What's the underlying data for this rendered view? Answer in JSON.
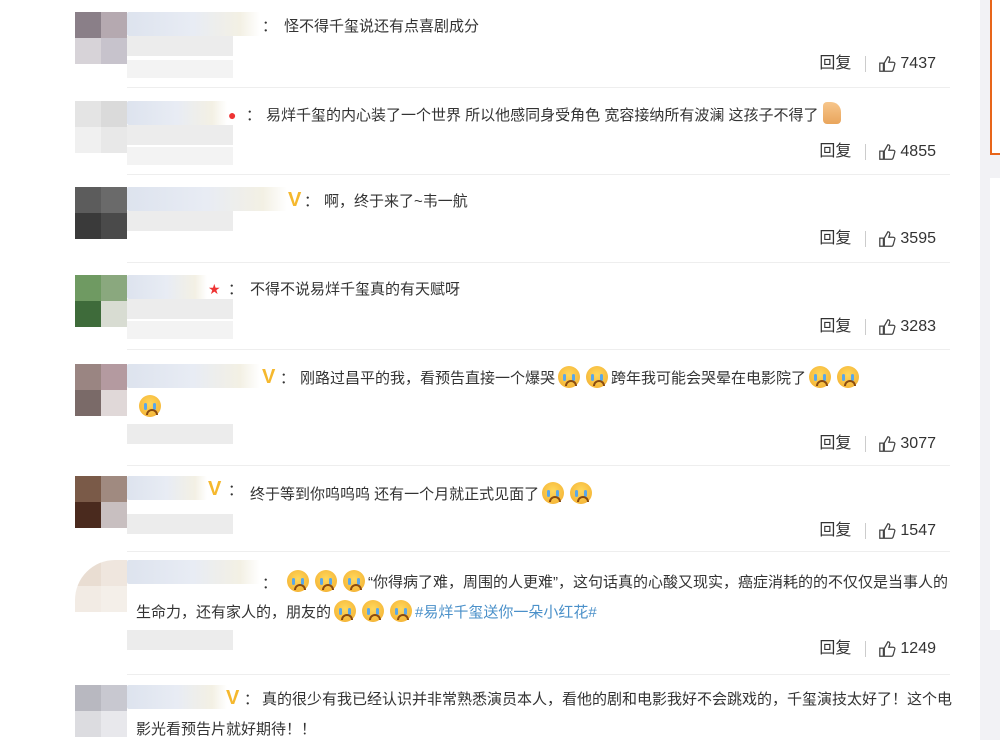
{
  "comments": [
    {
      "sep": "：",
      "text": "怪不得千玺说还有点喜剧成分",
      "reply": "回复",
      "likes": "7437"
    },
    {
      "sep": "：",
      "text": "易烊千玺的内心装了一个世界 所以他感同身受角色 宽容接纳所有波澜 这孩子不得了",
      "reply": "回复",
      "likes": "4855"
    },
    {
      "sep": "：",
      "text": "啊，终于来了~韦一航",
      "reply": "回复",
      "likes": "3595"
    },
    {
      "sep": "：",
      "text": "不得不说易烊千玺真的有天赋呀",
      "reply": "回复",
      "likes": "3283"
    },
    {
      "sep": "：",
      "text_a": "刚路过昌平的我，看预告直接一个爆哭",
      "text_b": "跨年我可能会哭晕在电影院了",
      "reply": "回复",
      "likes": "3077"
    },
    {
      "sep": "：",
      "text": "终于等到你呜呜呜 还有一个月就正式见面了",
      "reply": "回复",
      "likes": "1547"
    },
    {
      "sep": "：",
      "text_a": "“你得病了难，周围的人更难”，这句话真的心酸又现实，癌症消耗的的不仅仅是当事人的生命力，还有家人的，朋友的",
      "hashtag": "#易烊千玺送你一朵小红花#",
      "reply": "回复",
      "likes": "1249"
    },
    {
      "sep": "：",
      "text": "真的很少有我已经认识并非常熟悉演员本人，看他的剧和电影我好不会跳戏的，千玺演技太好了！这个电影光看预告片就好期待！！"
    }
  ],
  "icons": {
    "like": "thumbs-up-icon",
    "emoji": "crying-face-icon",
    "thumb_emoji": "thumbs-up-emoji-icon"
  },
  "colors": {
    "hashtag": "#4a90c9",
    "badge": "#f5b82e",
    "accent": "#e8651a"
  }
}
